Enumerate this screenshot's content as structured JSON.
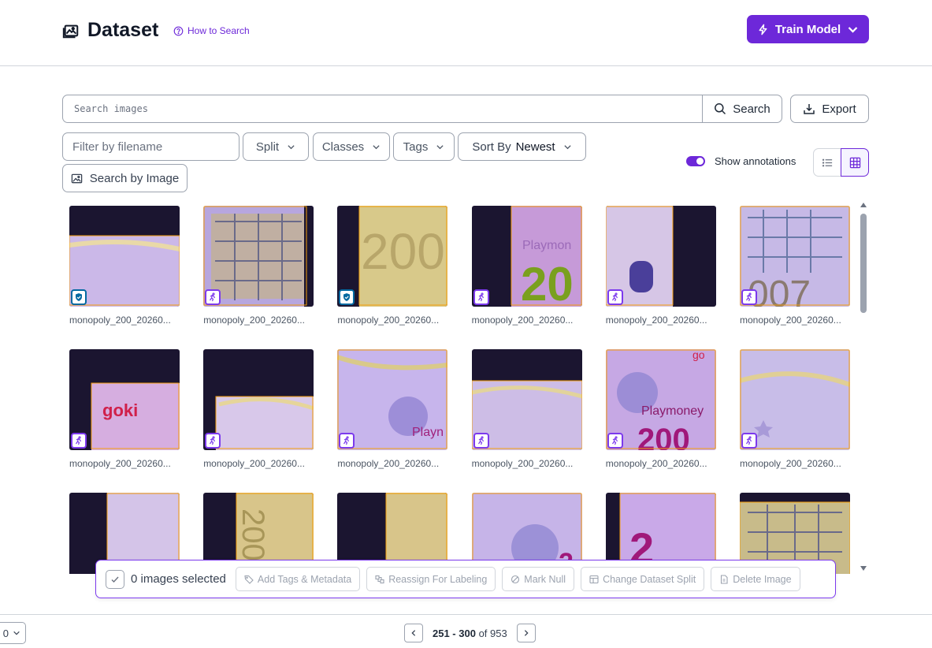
{
  "header": {
    "title": "Dataset",
    "title_icon": "image-icon",
    "how_to_search": "How to Search",
    "train_button": "Train Model"
  },
  "search": {
    "placeholder": "Search images",
    "value": "",
    "button": "Search",
    "export": "Export"
  },
  "filters": {
    "filename_placeholder": "Filter by filename",
    "split": "Split",
    "classes": "Classes",
    "tags": "Tags",
    "sort_label": "Sort By",
    "sort_value": "Newest",
    "search_by_image": "Search by Image"
  },
  "view": {
    "show_annotations_label": "Show annotations",
    "show_annotations": true,
    "mode": "grid"
  },
  "images": [
    {
      "name": "monopoly_200_20260...",
      "badge": "shield-icon",
      "art": "a1"
    },
    {
      "name": "monopoly_200_20260...",
      "badge": "run-icon",
      "art": "a2"
    },
    {
      "name": "monopoly_200_20260...",
      "badge": "shield-icon",
      "art": "a3"
    },
    {
      "name": "monopoly_200_20260...",
      "badge": "run-icon",
      "art": "a4"
    },
    {
      "name": "monopoly_200_20260...",
      "badge": "run-icon",
      "art": "a5"
    },
    {
      "name": "monopoly_200_20260...",
      "badge": "run-icon",
      "art": "a6"
    },
    {
      "name": "monopoly_200_20260...",
      "badge": "run-icon",
      "art": "b1"
    },
    {
      "name": "monopoly_200_20260...",
      "badge": "run-icon",
      "art": "b2"
    },
    {
      "name": "monopoly_200_20260...",
      "badge": "run-icon",
      "art": "b3"
    },
    {
      "name": "monopoly_200_20260...",
      "badge": "run-icon",
      "art": "b4"
    },
    {
      "name": "monopoly_200_20260...",
      "badge": "run-icon",
      "art": "b5"
    },
    {
      "name": "monopoly_200_20260...",
      "badge": "run-icon",
      "art": "b6"
    },
    {
      "name": "",
      "badge": "",
      "art": "c1"
    },
    {
      "name": "",
      "badge": "",
      "art": "c2"
    },
    {
      "name": "",
      "badge": "",
      "art": "c3"
    },
    {
      "name": "",
      "badge": "",
      "art": "c4"
    },
    {
      "name": "",
      "badge": "",
      "art": "c5"
    },
    {
      "name": "",
      "badge": "",
      "art": "c6"
    }
  ],
  "action_bar": {
    "selected_text": "0 images selected",
    "add_tags": "Add Tags & Metadata",
    "reassign": "Reassign For Labeling",
    "mark_null": "Mark Null",
    "change_split": "Change Dataset Split",
    "delete": "Delete Image"
  },
  "pagination": {
    "per_page": "0",
    "range": "251 - 300",
    "of": "of",
    "total": "953"
  },
  "colors": {
    "accent": "#6d28d9",
    "badge_purple": "#7c3aed",
    "badge_blue": "#0369a1",
    "annotation_box": "#f59e0b"
  }
}
